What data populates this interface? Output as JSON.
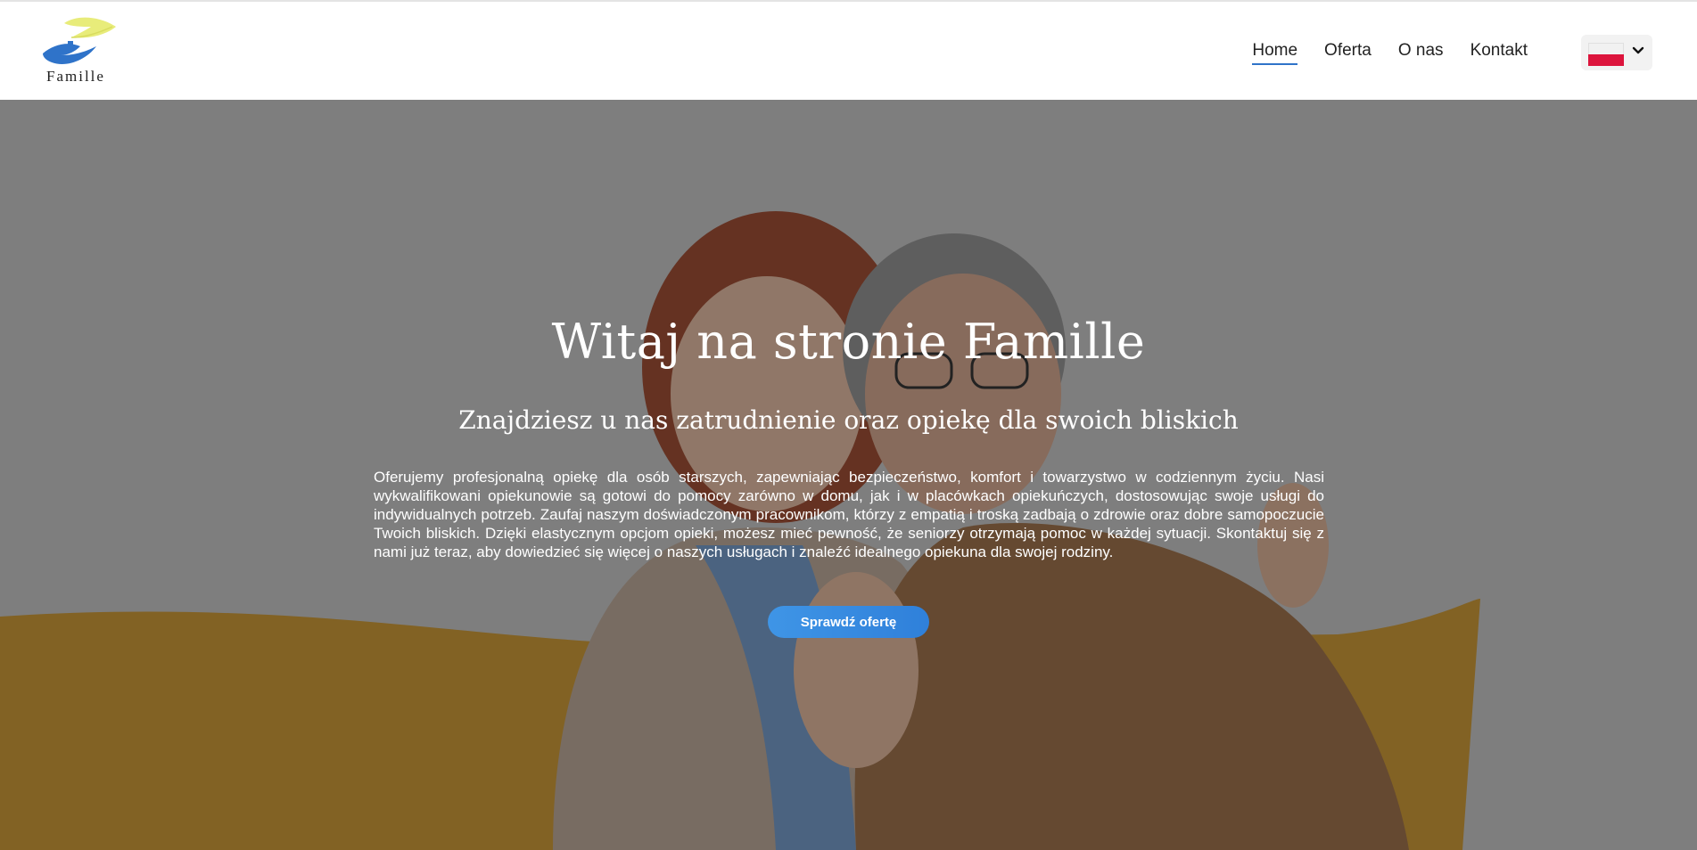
{
  "brand": {
    "name": "Famille",
    "logo_icon": "hands-sun-icon",
    "colors": {
      "blue": "#2f73c9",
      "yellow": "#e8ec7a"
    }
  },
  "nav": {
    "items": [
      {
        "label": "Home",
        "active": true
      },
      {
        "label": "Oferta",
        "active": false
      },
      {
        "label": "O nas",
        "active": false
      },
      {
        "label": "Kontakt",
        "active": false
      }
    ]
  },
  "language_selector": {
    "selected_flag_icon": "poland-flag-icon",
    "dropdown_icon": "chevron-down-icon",
    "colors": {
      "flag_white": "#f1f1f1",
      "flag_red": "#dc143c"
    }
  },
  "hero": {
    "title": "Witaj na stronie Famille",
    "subtitle": "Znajdziesz u nas zatrudnienie oraz opiekę dla swoich bliskich",
    "body": "Oferujemy profesjonalną opiekę dla osób starszych, zapewniając bezpieczeństwo, komfort i towarzystwo w codziennym życiu. Nasi wykwalifikowani opiekunowie są gotowi do pomocy zarówno w domu, jak i w placówkach opiekuńczych, dostosowując swoje usługi do indywidualnych potrzeb. Zaufaj naszym doświadczonym pracownikom, którzy z empatią i troską zadbają o zdrowie oraz dobre samopoczucie Twoich bliskich. Dzięki elastycznym opcjom opieki, możesz mieć pewność, że seniorzy otrzymają pomoc w każdej sytuacji. Skontaktuj się z nami już teraz, aby dowiedzieć się więcej o naszych usługach i znaleźć idealnego opiekuna dla swojej rodziny.",
    "cta_label": "Sprawdź ofertę",
    "background_description_icon": "caregiver-with-senior-photo",
    "colors": {
      "button": "#2f80da"
    }
  }
}
